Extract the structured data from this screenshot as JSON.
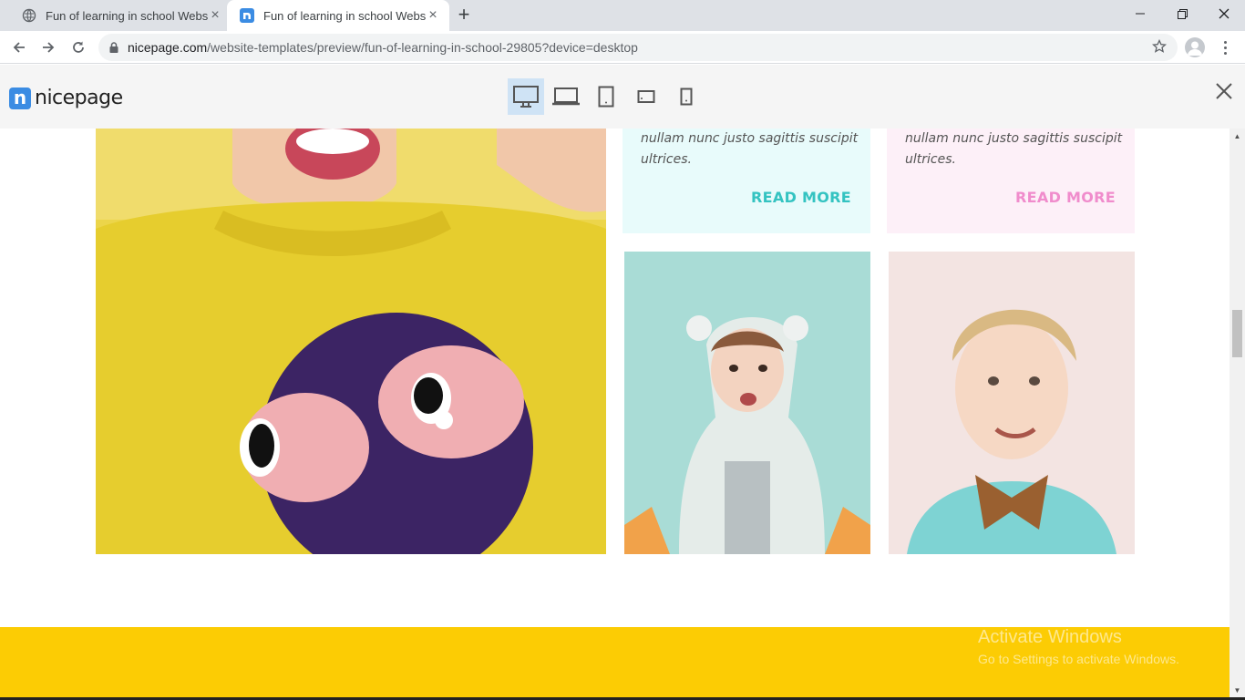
{
  "browser": {
    "tabs": [
      {
        "title": "Fun of learning in school Website",
        "active": false
      },
      {
        "title": "Fun of learning in school Website",
        "active": true
      }
    ],
    "url_host": "nicepage.com",
    "url_path": "/website-templates/preview/fun-of-learning-in-school-29805?device=desktop"
  },
  "preview_bar": {
    "logo_text": "nicepage",
    "devices": [
      "desktop-icon",
      "laptop-icon",
      "tablet-portrait-icon",
      "tablet-landscape-icon",
      "phone-icon"
    ],
    "active_device": "desktop"
  },
  "cards": [
    {
      "text": "nullam nunc justo sagittis suscipit ultrices.",
      "link": "READ MORE",
      "bg": "#e8fbfb",
      "accent": "#34c3c1"
    },
    {
      "text": "nullam nunc justo sagittis suscipit ultrices.",
      "link": "READ MORE",
      "bg": "#fdf0f8",
      "accent": "#f08ccc"
    }
  ],
  "footer": {
    "color": "#fccc04"
  },
  "watermark": {
    "line1": "Activate Windows",
    "line2": "Go to Settings to activate Windows."
  }
}
